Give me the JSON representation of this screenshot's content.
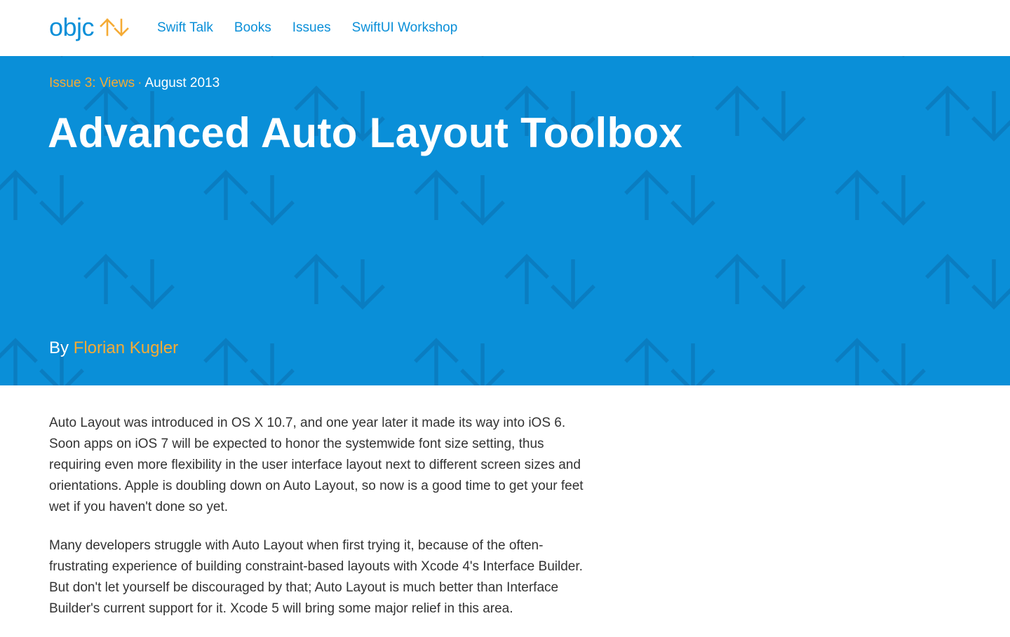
{
  "site": {
    "logo_text": "objc",
    "logo_icon": "up-down-arrows-icon",
    "brand_color": "#0a8fd8",
    "accent_color": "#f5ab35"
  },
  "nav": {
    "items": [
      {
        "label": "Swift Talk"
      },
      {
        "label": "Books"
      },
      {
        "label": "Issues"
      },
      {
        "label": "SwiftUI Workshop"
      }
    ]
  },
  "hero": {
    "issue_label": "Issue 3: Views",
    "separator": "·",
    "date": "August 2013",
    "title": "Advanced Auto Layout Toolbox",
    "by_prefix": "By",
    "author": "Florian Kugler",
    "background_color": "#0a8fd8",
    "pattern_icon": "up-down-arrows-icon"
  },
  "article": {
    "paragraphs": [
      "Auto Layout was introduced in OS X 10.7, and one year later it made its way into iOS 6. Soon apps on iOS 7 will be expected to honor the systemwide font size setting, thus requiring even more flexibility in the user interface layout next to different screen sizes and orientations. Apple is doubling down on Auto Layout, so now is a good time to get your feet wet if you haven't done so yet.",
      "Many developers struggle with Auto Layout when first trying it, because of the often-frustrating experience of building constraint-based layouts with Xcode 4's Interface Builder. But don't let yourself be discouraged by that; Auto Layout is much better than Interface Builder's current support for it. Xcode 5 will bring some major relief in this area."
    ]
  }
}
